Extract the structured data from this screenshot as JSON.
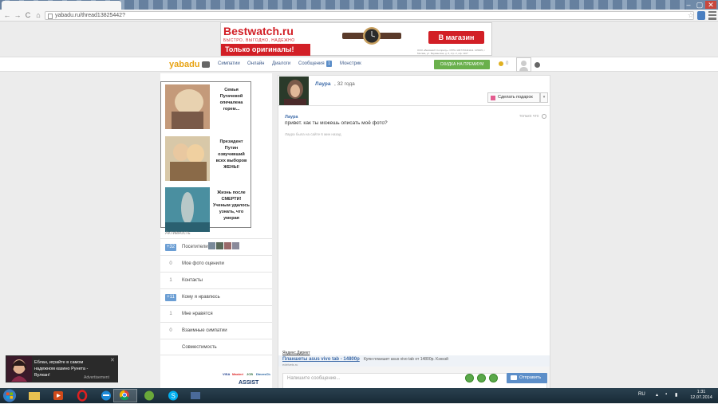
{
  "browser": {
    "url": "yabadu.ru/thread13825442?",
    "nav": {
      "back": "←",
      "forward": "→",
      "reload": "C",
      "home": "⌂"
    },
    "star": "☆",
    "window": {
      "minimize": "–",
      "maximize": "▢",
      "close": "✕"
    }
  },
  "banner": {
    "brand": "Bestwatch.ru",
    "slogan": "БЫСТРО, ВЫГОДНО, НАДЕЖНО",
    "tagline": "Только оригиналы!",
    "button": "В магазин",
    "fine_print": "ООО «Bestwatch Company». ОГРН 1067746441111. 105005, г. Москва, ул. Бауманская, д. 6, стр. 2, оф. 1107",
    "colors": {
      "brand_red": "#d21f26"
    }
  },
  "sitenav": {
    "logo": "yabadu",
    "links": [
      "Симпатии",
      "Онлайн",
      "Диалоги",
      "Сообщения",
      "Монстрик"
    ],
    "messages_badge": "1",
    "premium_button": "СКИДКА НА ПРЕМИУМ",
    "coins": "0"
  },
  "news": [
    {
      "title": "Семья Пугачевой опечалена горем..."
    },
    {
      "title": "Президент Путин озвучивший всех выборов ЖЕНЫ!"
    },
    {
      "title": "Жизнь после СМЕРТИ! Ученым удалось узнать, что умерая"
    }
  ],
  "activity": {
    "heading": "Активность",
    "rows": [
      {
        "count": "+32",
        "label": "Посетители",
        "highlight": true
      },
      {
        "count": "0",
        "label": "Мое фото оценили",
        "highlight": false
      },
      {
        "count": "1",
        "label": "Контакты",
        "highlight": false
      },
      {
        "count": "+11",
        "label": "Кому я нравлюсь",
        "highlight": true
      },
      {
        "count": "1",
        "label": "Мне нравятся",
        "highlight": false
      },
      {
        "count": "0",
        "label": "Взаимные симпатии",
        "highlight": false
      },
      {
        "count": "",
        "label": "Совместимость",
        "highlight": false
      }
    ]
  },
  "payments": [
    "VISA",
    "MasterCard",
    "JCB",
    "DinersClub",
    "ASSIST"
  ],
  "conversation": {
    "name": "Лаура",
    "age": ", 32 года",
    "gift_button": "Сделать подарок",
    "message": {
      "sender": "Лаура",
      "text": "привет. как ты можешь описать моё фото?",
      "time": "только что"
    },
    "status": "Лаура была на сайте 6 мин назад",
    "yandex_label": "Яндекс.Директ",
    "ad": {
      "link": "Планшеты asus vivo tab - 14800р",
      "desc": "Купи планшет asus vivo tab от 14800р. Кэнкэй",
      "domain": "edelveis.ru"
    },
    "compose_placeholder": "Напишите сообщение...",
    "send_button": "Отправить"
  },
  "casino_ad": {
    "text": "Еблан, играйте в самом надежном казино Рунета - Вулкан!",
    "ad_label": "Advertisement"
  },
  "taskbar": {
    "lang": "RU",
    "time": "1:31",
    "date": "12.07.2014"
  }
}
